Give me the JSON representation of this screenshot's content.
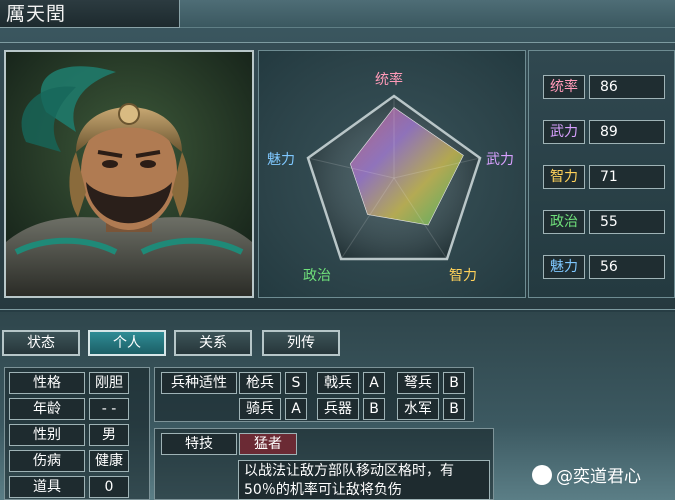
{
  "general": {
    "name": "厲天閏"
  },
  "radar": {
    "labels": {
      "command": "统率",
      "war": "武力",
      "intel": "智力",
      "politics": "政治",
      "charm": "魅力"
    },
    "colors": {
      "command": "#ff9ab8",
      "war": "#d8a0ff",
      "intel": "#ffd25a",
      "politics": "#6fe07a",
      "charm": "#7fc8ff"
    }
  },
  "stats": [
    {
      "label": "统率",
      "value": "86",
      "color": "#ff9ab8"
    },
    {
      "label": "武力",
      "value": "89",
      "color": "#d8a0ff"
    },
    {
      "label": "智力",
      "value": "71",
      "color": "#ffd25a"
    },
    {
      "label": "政治",
      "value": "55",
      "color": "#6fe07a"
    },
    {
      "label": "魅力",
      "value": "56",
      "color": "#7fc8ff"
    }
  ],
  "tabs": [
    {
      "label": "状态",
      "active": false
    },
    {
      "label": "个人",
      "active": true
    },
    {
      "label": "关系",
      "active": false
    },
    {
      "label": "列传",
      "active": false
    }
  ],
  "personal": [
    {
      "key": "性格",
      "value": "刚胆"
    },
    {
      "key": "年龄",
      "value": "- -"
    },
    {
      "key": "性别",
      "value": "男"
    },
    {
      "key": "伤病",
      "value": "健康"
    },
    {
      "key": "道具",
      "value": "0"
    }
  ],
  "troops": {
    "header": "兵种适性",
    "items": [
      {
        "name": "枪兵",
        "grade": "S"
      },
      {
        "name": "戟兵",
        "grade": "A"
      },
      {
        "name": "弩兵",
        "grade": "B"
      },
      {
        "name": "骑兵",
        "grade": "A"
      },
      {
        "name": "兵器",
        "grade": "B"
      },
      {
        "name": "水军",
        "grade": "B"
      }
    ]
  },
  "skill": {
    "header": "特技",
    "name": "猛者",
    "desc_line1": "以战法让敌方部队移动区格时，有",
    "desc_line2": "50％的机率可让敌将负伤"
  },
  "watermark": "@奕道君心"
}
